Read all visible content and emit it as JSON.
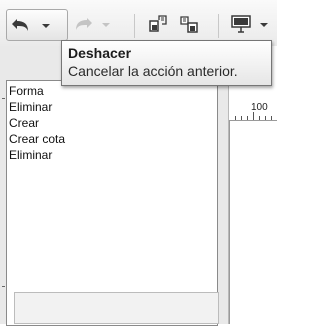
{
  "toolbar": {
    "undo_icon": "undo-arrow-icon",
    "redo_icon": "redo-arrow-icon",
    "copy_icon": "copy-format-icon",
    "paste_icon": "paste-format-icon",
    "present_icon": "slide-show-icon",
    "dropdown_icon": "chevron-down-icon"
  },
  "tooltip": {
    "title": "Deshacer",
    "description": "Cancelar la acción anterior."
  },
  "history": {
    "items": [
      {
        "label": "Forma"
      },
      {
        "label": "Eliminar"
      },
      {
        "label": "Crear"
      },
      {
        "label": "Crear cota"
      },
      {
        "label": "Eliminar"
      }
    ]
  },
  "ruler": {
    "label": "100"
  },
  "colors": {
    "toolbar_bg": "#efefef",
    "panel_bg": "#e9e9e9",
    "tooltip_border": "#767676",
    "icon_dark": "#3a3a3a",
    "icon_disabled": "#b5b5b5"
  }
}
